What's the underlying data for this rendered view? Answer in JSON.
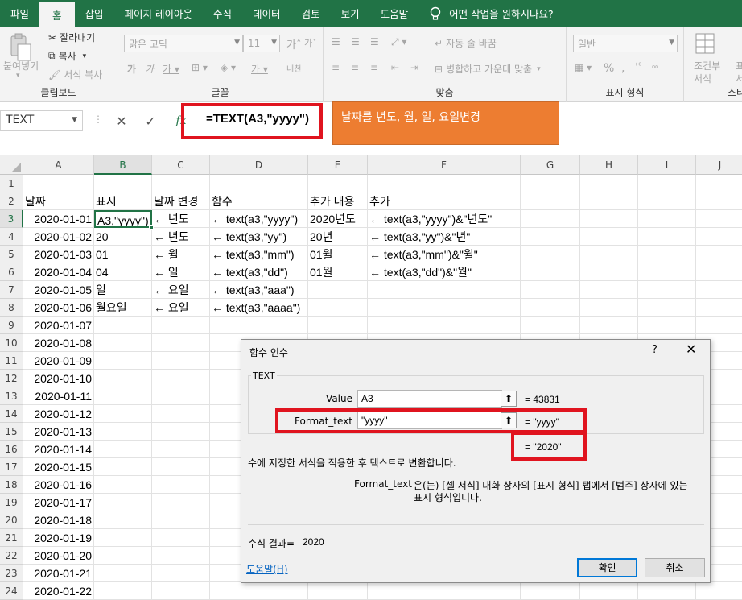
{
  "tabs": [
    "파일",
    "홈",
    "삽입",
    "페이지 레이아웃",
    "수식",
    "데이터",
    "검토",
    "보기",
    "도움말"
  ],
  "active_tab": "홈",
  "tellme": "어떤 작업을 원하시나요?",
  "ribbon": {
    "clipboard": {
      "paste": "붙여넣기",
      "cut": "잘라내기",
      "copy": "복사",
      "format_painter": "서식 복사",
      "label": "클립보드"
    },
    "font": {
      "name": "맑은 고딕",
      "size": "11",
      "label": "글꼴"
    },
    "align": {
      "wrap": "자동 줄 바꿈",
      "merge": "병합하고 가운데 맞춤",
      "label": "맞춤"
    },
    "number": {
      "format": "일반",
      "label": "표시 형식"
    },
    "styles": {
      "cond1": "조건부",
      "cond2": "서식",
      "table1": "표",
      "table2": "서식",
      "label": "스타"
    }
  },
  "formula_bar": {
    "name_box": "TEXT",
    "cancel": "✕",
    "enter": "✓",
    "fx": "fx",
    "formula": "=TEXT(A3,\"yyyy\")"
  },
  "callout": "날짜를 년도, 월, 일, 요일변경",
  "columns": [
    "A",
    "B",
    "C",
    "D",
    "E",
    "F",
    "G",
    "H",
    "I",
    "J"
  ],
  "rows": [
    [
      "",
      "",
      "",
      "",
      "",
      ""
    ],
    [
      "날짜",
      "표시",
      "날짜 변경",
      "함수",
      "추가 내용",
      "추가"
    ],
    [
      "2020-01-01",
      "A3,\"yyyy\")",
      "← 년도",
      "← text(a3,\"yyyy\")",
      "2020년도",
      "← text(a3,\"yyyy\")&\"년도\""
    ],
    [
      "2020-01-02",
      "20",
      "← 년도",
      "← text(a3,\"yy\")",
      "20년",
      "← text(a3,\"yy\")&\"년\""
    ],
    [
      "2020-01-03",
      "01",
      "← 월",
      "← text(a3,\"mm\")",
      "01월",
      "← text(a3,\"mm\")&\"월\""
    ],
    [
      "2020-01-04",
      "04",
      "← 일",
      "← text(a3,\"dd\")",
      "01월",
      "← text(a3,\"dd\")&\"월\""
    ],
    [
      "2020-01-05",
      "일",
      "← 요일",
      "← text(a3,\"aaa\")",
      "",
      ""
    ],
    [
      "2020-01-06",
      "월요일",
      "← 요일",
      "← text(a3,\"aaaa\")",
      "",
      ""
    ],
    [
      "2020-01-07",
      "",
      "",
      "",
      "",
      ""
    ],
    [
      "2020-01-08",
      "",
      "",
      "",
      "",
      ""
    ],
    [
      "2020-01-09",
      "",
      "",
      "",
      "",
      ""
    ],
    [
      "2020-01-10",
      "",
      "",
      "",
      "",
      ""
    ],
    [
      "2020-01-11",
      "",
      "",
      "",
      "",
      ""
    ],
    [
      "2020-01-12",
      "",
      "",
      "",
      "",
      ""
    ],
    [
      "2020-01-13",
      "",
      "",
      "",
      "",
      ""
    ],
    [
      "2020-01-14",
      "",
      "",
      "",
      "",
      ""
    ],
    [
      "2020-01-15",
      "",
      "",
      "",
      "",
      ""
    ],
    [
      "2020-01-16",
      "",
      "",
      "",
      "",
      ""
    ],
    [
      "2020-01-17",
      "",
      "",
      "",
      "",
      ""
    ],
    [
      "2020-01-18",
      "",
      "",
      "",
      "",
      ""
    ],
    [
      "2020-01-19",
      "",
      "",
      "",
      "",
      ""
    ],
    [
      "2020-01-20",
      "",
      "",
      "",
      "",
      ""
    ],
    [
      "2020-01-21",
      "",
      "",
      "",
      "",
      ""
    ],
    [
      "2020-01-22",
      "",
      "",
      "",
      "",
      ""
    ]
  ],
  "dialog": {
    "title": "함수 인수",
    "help_glyph": "?",
    "close_glyph": "✕",
    "function_name": "TEXT",
    "args": [
      {
        "label": "Value",
        "input": "A3",
        "result": "=  43831"
      },
      {
        "label": "Format_text",
        "input": "\"yyyy\"",
        "result": "=  \"yyyy\""
      }
    ],
    "total_result": "=  \"2020\"",
    "description": "수에 지정한 서식을 적용한 후 텍스트로 변환합니다.",
    "arg_help_name": "Format_text",
    "arg_help_text1": "은(는) [셀 서식] 대화 상자의 [표시 형식] 탭에서 [범주] 상자에 있는",
    "arg_help_text2": "표시 형식입니다.",
    "formula_result_label": "수식 결과=",
    "formula_result_value": "2020",
    "help_link": "도움말(H)",
    "ok": "확인",
    "cancel": "취소"
  },
  "colors": {
    "excel_green": "#217346",
    "highlight_red": "#e0141f",
    "callout_orange": "#ed7d31"
  }
}
